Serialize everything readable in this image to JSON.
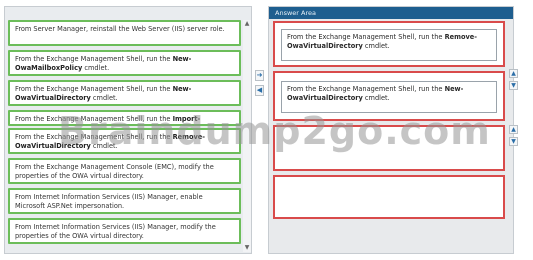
{
  "left": {
    "items": [
      {
        "pre": "From Server Manager, reinstall the Web Server (IIS) server role.",
        "bold": "",
        "post": ""
      },
      {
        "pre": "From the Exchange Management Shell, run the ",
        "bold": "New-OwaMailboxPolicy",
        "post": " cmdlet."
      },
      {
        "pre": "From the Exchange Management Shell, run the ",
        "bold": "New-OwaVirtualDirectory",
        "post": " cmdlet."
      },
      {
        "pre": "From the Exchange Management Shell, run the ",
        "bold": "Import-",
        "post": ""
      },
      {
        "pre": "From the Exchange Management Shell, run the ",
        "bold": "Remove-OwaVirtualDirectory",
        "post": " cmdlet."
      },
      {
        "pre": "From the Exchange Management Console (EMC), modify the properties of the OWA virtual directory.",
        "bold": "",
        "post": ""
      },
      {
        "pre": "From Internet Information Services (IIS) Manager, enable Microsoft ASP.Net impersonation.",
        "bold": "",
        "post": ""
      },
      {
        "pre": "From Internet Information Services (IIS) Manager, modify the properties of the OWA virtual directory.",
        "bold": "",
        "post": ""
      }
    ]
  },
  "answer": {
    "header": "Answer Area",
    "slots": [
      {
        "pre": "From the Exchange Management Shell, run the ",
        "bold": "Remove-OwaVirtualDirectory",
        "post": " cmdlet."
      },
      {
        "pre": "From the Exchange Management Shell, run the ",
        "bold": "New-OwaVirtualDirectory",
        "post": " cmdlet."
      },
      {
        "pre": "",
        "bold": "",
        "post": ""
      },
      {
        "pre": "",
        "bold": "",
        "post": ""
      }
    ]
  },
  "watermark": "Braindump2go.com",
  "icons": {
    "scroll_up": "▲",
    "scroll_down": "▼",
    "move_right": "➜",
    "move_left": "◀",
    "move_up": "▲",
    "move_down": "▼"
  }
}
